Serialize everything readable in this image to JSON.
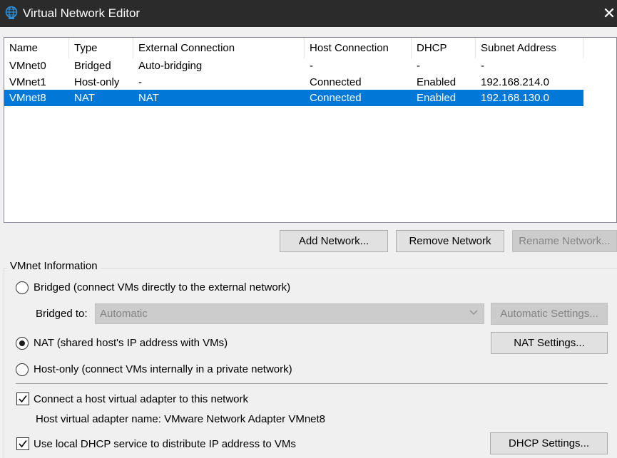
{
  "window": {
    "title": "Virtual Network Editor",
    "close_glyph": "✕"
  },
  "table": {
    "columns": [
      "Name",
      "Type",
      "External Connection",
      "Host Connection",
      "DHCP",
      "Subnet Address"
    ],
    "rows": [
      [
        "VMnet0",
        "Bridged",
        "Auto-bridging",
        "-",
        "-",
        "-"
      ],
      [
        "VMnet1",
        "Host-only",
        "-",
        "Connected",
        "Enabled",
        "192.168.214.0"
      ],
      [
        "VMnet8",
        "NAT",
        "NAT",
        "Connected",
        "Enabled",
        "192.168.130.0"
      ]
    ],
    "selected_row": "VMnet8"
  },
  "buttons": {
    "add_network": "Add Network...",
    "remove_network": "Remove Network",
    "rename_network": "Rename Network..."
  },
  "vmnet_info": {
    "group_label": "VMnet Information",
    "bridged_option": "Bridged (connect VMs directly to the external network)",
    "bridged_to_label": "Bridged to:",
    "bridged_to_value": "Automatic",
    "automatic_settings": "Automatic Settings...",
    "nat_option": "NAT (shared host's IP address with VMs)",
    "nat_settings": "NAT Settings...",
    "hostonly_option": "Host-only (connect VMs internally in a private network)",
    "selected_mode": "NAT",
    "connect_adapter_label": "Connect a host virtual adapter to this network",
    "connect_adapter_checked": true,
    "adapter_name_text": "Host virtual adapter name: VMware Network Adapter VMnet8",
    "dhcp_label": "Use local DHCP service to distribute IP address to VMs",
    "dhcp_checked": true,
    "dhcp_settings": "DHCP Settings..."
  },
  "colors": {
    "selection": "#0078d7",
    "titlebar": "#2b2b2b"
  },
  "icons": {
    "app": "globe-network-icon",
    "close": "close-icon",
    "dropdown": "chevron-down-icon",
    "check": "checkmark-icon"
  }
}
